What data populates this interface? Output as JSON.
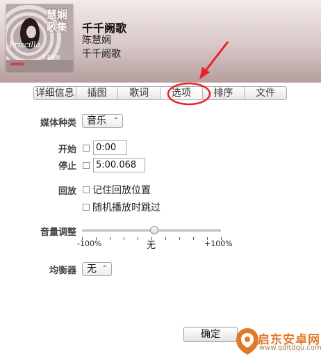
{
  "track": {
    "title": "千千阙歌",
    "artist": "陈慧娴",
    "album": "千千阙歌",
    "art_text_main": "慧娴\n歌集",
    "art_text_script": "Priscilla",
    "art_text_small": "千千阙歌"
  },
  "tabs": [
    {
      "label": "详细信息"
    },
    {
      "label": "插图"
    },
    {
      "label": "歌词"
    },
    {
      "label": "选项",
      "active": true
    },
    {
      "label": "排序"
    },
    {
      "label": "文件"
    }
  ],
  "options": {
    "media_kind_label": "媒体种类",
    "media_kind_value": "音乐",
    "start_label": "开始",
    "start_value": "0:00",
    "stop_label": "停止",
    "stop_value": "5:00.068",
    "playback_label": "回放",
    "remember_position_label": "记住回放位置",
    "skip_shuffle_label": "随机播放时跳过",
    "volume_label": "音量调整",
    "volume_min": "-100%",
    "volume_mid": "无",
    "volume_max": "+100%",
    "volume_adjust_percent": 0,
    "equalizer_label": "均衡器",
    "equalizer_value": "无"
  },
  "footer": {
    "ok_label": "确定"
  },
  "watermark": {
    "text": "启东安卓网",
    "url": "www.qdltdqu.com"
  },
  "colors": {
    "annotation_red": "#e8232a",
    "watermark_orange": "#e07a2b"
  }
}
